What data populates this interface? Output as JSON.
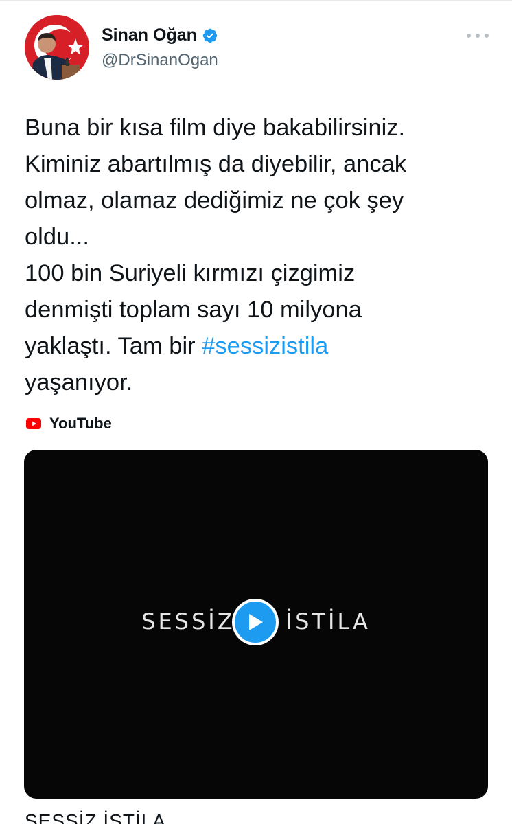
{
  "author": {
    "name": "Sinan Oğan",
    "handle": "@DrSinanOgan",
    "verified": true
  },
  "tweet": {
    "lines": [
      "Buna bir kısa film diye bakabilirsiniz.",
      "Kiminiz abartılmış da diyebilir, ancak",
      "olmaz, olamaz dediğimiz ne çok şey",
      "oldu...",
      "100 bin Suriyeli kırmızı çizgimiz",
      "denmişti toplam sayı 10 milyona"
    ],
    "line7_prefix": "yaklaştı. Tam bir ",
    "hashtag": "#sessizistila",
    "line8": "yaşanıyor."
  },
  "card": {
    "source": "YouTube",
    "video_overlay_left": "SESSİZ",
    "video_overlay_right": "İSTİLA",
    "title": "SESSİZ İSTİLA"
  },
  "colors": {
    "link": "#1d9bf0",
    "secondary_text": "#536471",
    "youtube_red": "#ff0000",
    "video_bg": "#060606"
  },
  "icons": {
    "verified": "verified-badge-icon",
    "more": "more-horizontal-icon",
    "source": "youtube-logo-icon",
    "play": "play-icon"
  }
}
